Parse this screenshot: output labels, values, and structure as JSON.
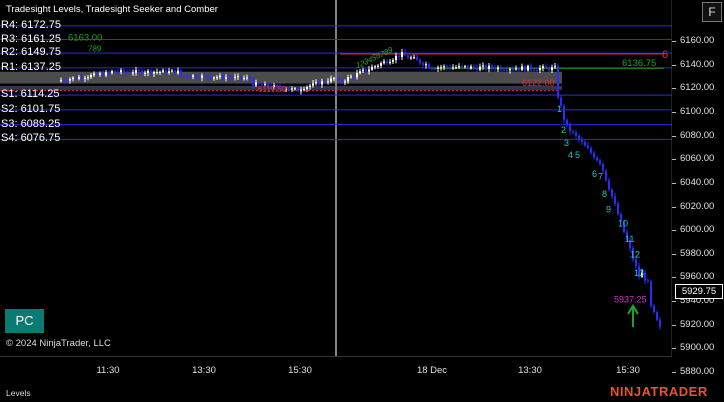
{
  "title": "Tradesight Levels, Tradesight Seeker and Comber",
  "f_button": "F",
  "pc_button": "PC",
  "copyright": "© 2024 NinjaTrader, LLC",
  "bottom_label": "Levels",
  "brand": "NINJATRADER",
  "last_price": "5929.75",
  "price_ticks": [
    "6160.00",
    "6140.00",
    "6120.00",
    "6100.00",
    "6080.00",
    "6060.00",
    "6040.00",
    "6020.00",
    "6000.00",
    "5980.00",
    "5960.00",
    "5940.00",
    "5920.00",
    "5900.00",
    "5880.00"
  ],
  "time_ticks": [
    "11:30",
    "13:30",
    "15:30",
    "18 Dec",
    "13:30",
    "15:30"
  ],
  "levels": [
    {
      "text": "R4: 6172.75",
      "price": 6172.75,
      "color": "#2a2ae6"
    },
    {
      "text": "R3: 6161.25",
      "price": 6161.25,
      "color": "#2a2ae6"
    },
    {
      "text": "R2: 6149.75",
      "price": 6149.75,
      "color": "#2a2ae6"
    },
    {
      "text": "R1: 6137.25",
      "price": 6137.25,
      "color": "#2a2ae6"
    },
    {
      "text": "S1: 6114.25",
      "price": 6114.25,
      "color": "#2a2ae6"
    },
    {
      "text": "S2: 6101.75",
      "price": 6101.75,
      "color": "#2a2ae6"
    },
    {
      "text": "S3: 6089.25",
      "price": 6089.25,
      "color": "#2a2ae6"
    },
    {
      "text": "S4: 6076.75",
      "price": 6076.75,
      "color": "#2a2ae6"
    }
  ],
  "chart_labels": {
    "seeker_green": "6136.75",
    "seeker_green_left": "6163.00",
    "red_label": "6122.00",
    "red_label_left": "6119.50",
    "magenta_label": "5937.25",
    "red_count": "6",
    "left_count": "789"
  },
  "countdown": [
    "1",
    "2",
    "3",
    "4",
    "5",
    "6",
    "7",
    "8",
    "9",
    "10",
    "11",
    "12",
    "13"
  ],
  "colors": {
    "up": "#ffffff",
    "down": "#2b2bff",
    "level": "#2a2ae6",
    "seeker": "#1fa31f",
    "comber": "#18c9c9",
    "accent": "#e8542f"
  }
}
